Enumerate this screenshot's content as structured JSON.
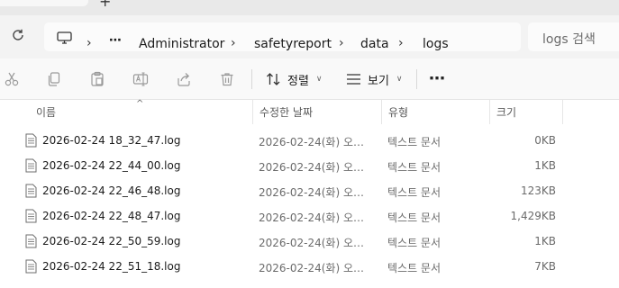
{
  "tabs": {
    "new_tab": "+"
  },
  "address": {
    "ellipsis": "⋯",
    "breadcrumbs": [
      "Administrator",
      "safetyreport",
      "data",
      "logs"
    ],
    "separator": "›",
    "search_placeholder": "logs 검색"
  },
  "toolbar": {
    "icons": [
      "cut-icon",
      "copy-icon",
      "paste-icon",
      "rename-icon",
      "share-icon",
      "delete-icon"
    ],
    "sort_label": "정렬",
    "view_label": "보기",
    "more_label": "⋯"
  },
  "columns": {
    "name": "이름",
    "modified": "수정한 날짜",
    "type": "유형",
    "size": "크기"
  },
  "files": [
    {
      "name": "2026-02-24 18_32_47.log",
      "modified": "2026-02-24(화) 오후 6:32",
      "type": "텍스트 문서",
      "size": "0KB"
    },
    {
      "name": "2026-02-24 22_44_00.log",
      "modified": "2026-02-24(화) 오후 10:44",
      "type": "텍스트 문서",
      "size": "1KB"
    },
    {
      "name": "2026-02-24 22_46_48.log",
      "modified": "2026-02-24(화) 오후 10:46",
      "type": "텍스트 문서",
      "size": "123KB"
    },
    {
      "name": "2026-02-24 22_48_47.log",
      "modified": "2026-02-24(화) 오후 10:48",
      "type": "텍스트 문서",
      "size": "1,429KB"
    },
    {
      "name": "2026-02-24 22_50_59.log",
      "modified": "2026-02-24(화) 오후 10:50",
      "type": "텍스트 문서",
      "size": "1KB"
    },
    {
      "name": "2026-02-24 22_51_18.log",
      "modified": "2026-02-24(화) 오후 10:51",
      "type": "텍스트 문서",
      "size": "7KB"
    }
  ],
  "colors": {
    "accent": "#0067c0",
    "toolbar_bg": "#f9f9f9",
    "address_bg": "#f3f3f3"
  }
}
